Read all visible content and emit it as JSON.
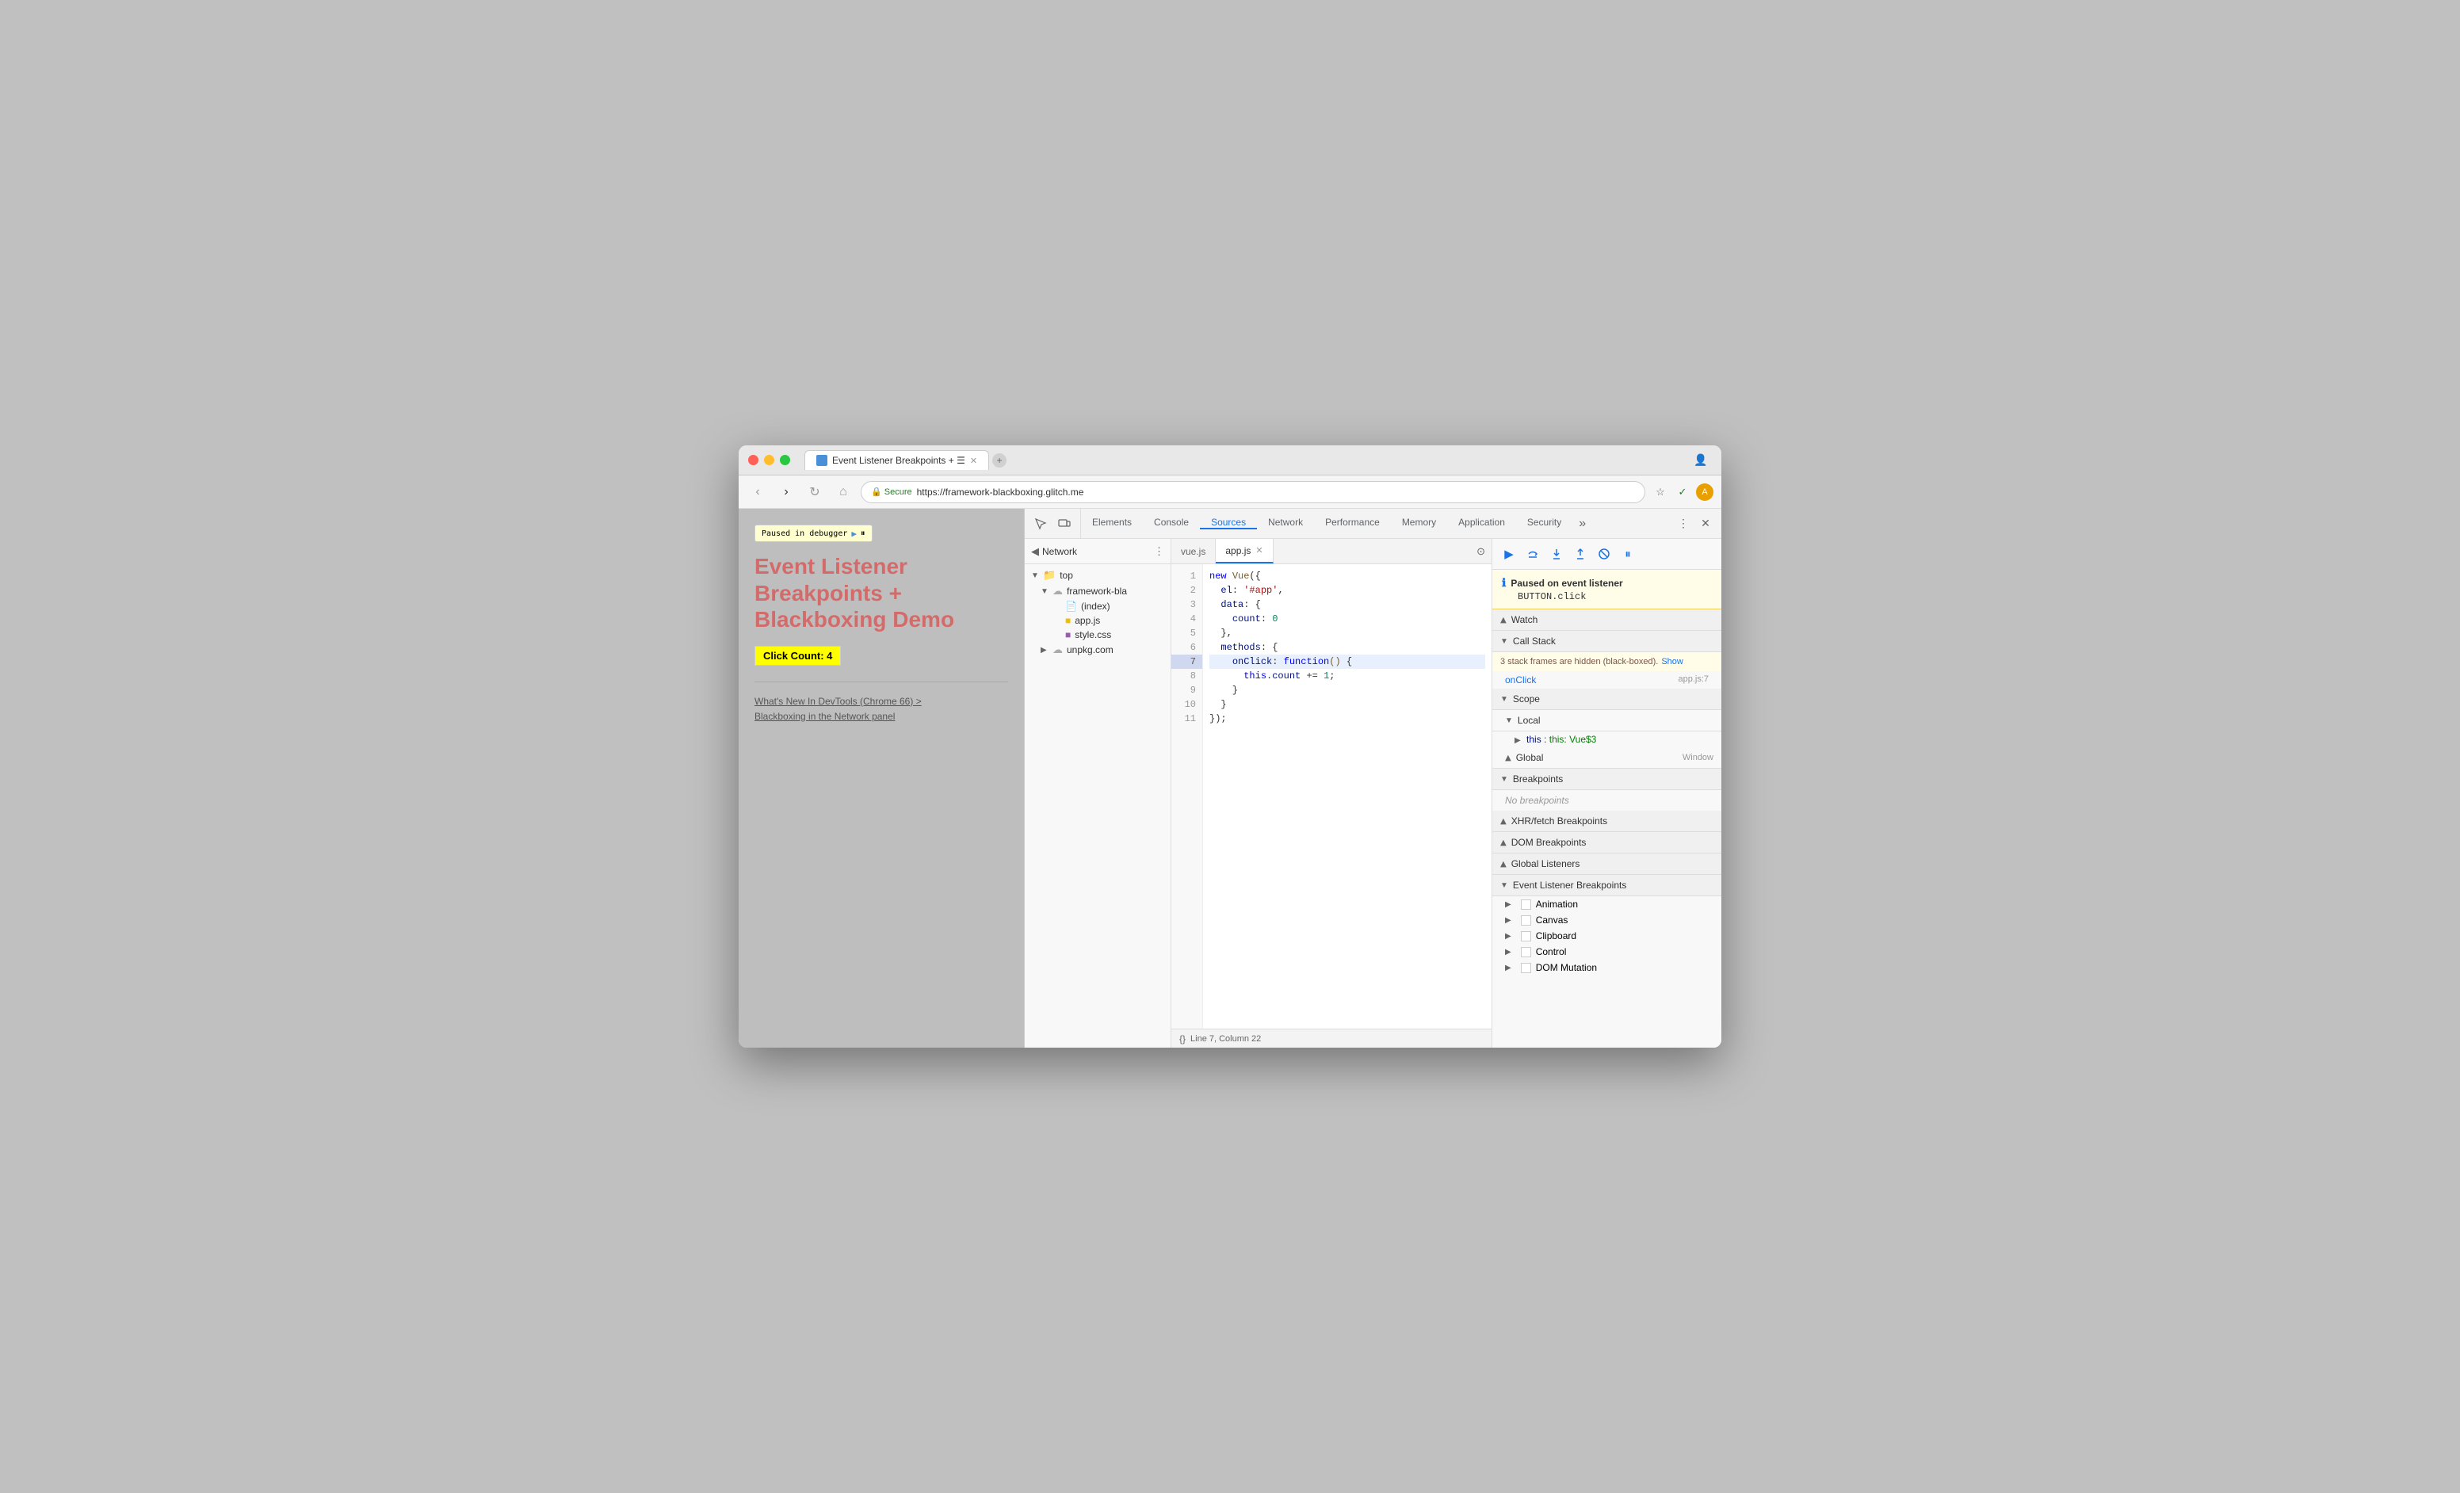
{
  "window": {
    "title": "Event Listener Breakpoints + Blackboxing Demo",
    "tab_label": "Event Listener Breakpoints + ☰",
    "url": "https://framework-blackboxing.glitch.me",
    "url_display": "https://framework-blackboxing.glitch.me"
  },
  "webpage": {
    "paused_label": "Paused in debugger",
    "title": "Event Listener Breakpoints + Blackboxing Demo",
    "click_count": "Click Count: 4",
    "link1": "What's New In DevTools (Chrome 66) >",
    "link2": "Blackboxing in the Network panel"
  },
  "devtools": {
    "tabs": [
      {
        "label": "Elements",
        "active": false
      },
      {
        "label": "Console",
        "active": false
      },
      {
        "label": "Sources",
        "active": true
      },
      {
        "label": "Network",
        "active": false
      },
      {
        "label": "Performance",
        "active": false
      },
      {
        "label": "Memory",
        "active": false
      },
      {
        "label": "Application",
        "active": false
      },
      {
        "label": "Security",
        "active": false
      }
    ]
  },
  "sources": {
    "network_tab": "Network",
    "file_tree": [
      {
        "label": "top",
        "type": "folder",
        "indent": 0
      },
      {
        "label": "framework-bla",
        "type": "cloud",
        "indent": 1
      },
      {
        "label": "(index)",
        "type": "file",
        "indent": 2
      },
      {
        "label": "app.js",
        "type": "js",
        "indent": 2
      },
      {
        "label": "style.css",
        "type": "css",
        "indent": 2
      },
      {
        "label": "unpkg.com",
        "type": "cloud",
        "indent": 1
      }
    ],
    "editor_tabs": [
      {
        "label": "vue.js",
        "active": false,
        "closable": false
      },
      {
        "label": "app.js",
        "active": true,
        "closable": true
      }
    ],
    "status_bar": "Line 7, Column 22",
    "code_lines": [
      {
        "num": 1,
        "content": "new Vue({",
        "highlighted": false
      },
      {
        "num": 2,
        "content": "  el: '#app',",
        "highlighted": false
      },
      {
        "num": 3,
        "content": "  data: {",
        "highlighted": false
      },
      {
        "num": 4,
        "content": "    count: 0",
        "highlighted": false
      },
      {
        "num": 5,
        "content": "  },",
        "highlighted": false
      },
      {
        "num": 6,
        "content": "  methods: {",
        "highlighted": false
      },
      {
        "num": 7,
        "content": "    onClick: function() {",
        "highlighted": true
      },
      {
        "num": 8,
        "content": "      this.count += 1;",
        "highlighted": false
      },
      {
        "num": 9,
        "content": "    }",
        "highlighted": false
      },
      {
        "num": 10,
        "content": "  }",
        "highlighted": false
      },
      {
        "num": 11,
        "content": "});",
        "highlighted": false
      }
    ]
  },
  "debugger": {
    "paused_title": "Paused on event listener",
    "paused_sub": "BUTTON.click",
    "sections": {
      "watch": "Watch",
      "call_stack": "Call Stack",
      "call_stack_warning": "3 stack frames are hidden (black-boxed).",
      "call_stack_show": "Show",
      "onclick_label": "onClick",
      "onclick_loc": "app.js:7",
      "scope": "Scope",
      "local": "Local",
      "this_val": "this: Vue$3",
      "global": "Global",
      "global_val": "Window",
      "breakpoints": "Breakpoints",
      "no_breakpoints": "No breakpoints",
      "xhr_breakpoints": "XHR/fetch Breakpoints",
      "dom_breakpoints": "DOM Breakpoints",
      "global_listeners": "Global Listeners",
      "event_listener_bp": "Event Listener Breakpoints",
      "animation": "Animation",
      "canvas": "Canvas",
      "clipboard": "Clipboard",
      "control": "Control",
      "dom_mutation": "DOM Mutation"
    }
  }
}
